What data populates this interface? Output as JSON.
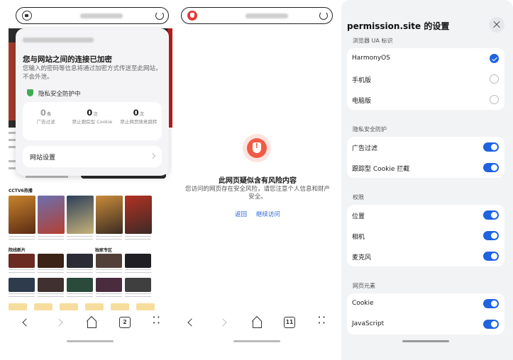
{
  "panel1": {
    "bg": {
      "section_cctv": "CCTV6热播",
      "section_hot": "院线新片",
      "section_special": "独家专区"
    },
    "popup": {
      "title": "您与网站之间的连接已加密",
      "desc": "您输入的密码等信息将通过加密方式传送至此网站，不会外泄。",
      "privacy": "隐私安全防护中",
      "stats": [
        {
          "num": "0",
          "unit": "条",
          "label": "广告过滤",
          "dim": true
        },
        {
          "num": "0",
          "unit": "次",
          "label": "禁止跟踪型 Cookie",
          "dim": false
        },
        {
          "num": "0",
          "unit": "次",
          "label": "禁止网页随意跳转",
          "dim": false
        }
      ],
      "site_settings": "网站设置"
    },
    "tab_count": "2"
  },
  "panel2": {
    "risk_title": "此网页疑似含有风险内容",
    "risk_desc": "您访问的网页存在安全风险，请您注意个人信息和财产安全。",
    "back": "返回",
    "continue": "继续访问",
    "tab_count": "11"
  },
  "panel3": {
    "title": "permission.site 的设置",
    "ua_section": "浏览器 UA 标识",
    "ua_options": [
      {
        "label": "HarmonyOS",
        "selected": true
      },
      {
        "label": "手机版",
        "selected": false
      },
      {
        "label": "电脑版",
        "selected": false
      }
    ],
    "privacy_section": "隐私安全防护",
    "privacy_items": [
      {
        "label": "广告过滤",
        "on": true
      },
      {
        "label": "跟踪型 Cookie 拦截",
        "on": true
      }
    ],
    "perm_section": "权限",
    "perm_items": [
      {
        "label": "位置",
        "on": true
      },
      {
        "label": "相机",
        "on": true
      },
      {
        "label": "麦克风",
        "on": true
      }
    ],
    "elem_section": "网页元素",
    "elem_items": [
      {
        "label": "Cookie",
        "on": true
      },
      {
        "label": "JavaScript",
        "on": true
      }
    ]
  },
  "colors": {
    "accent": "#1f63e0",
    "danger": "#ef5b45",
    "safe": "#3dab51"
  }
}
